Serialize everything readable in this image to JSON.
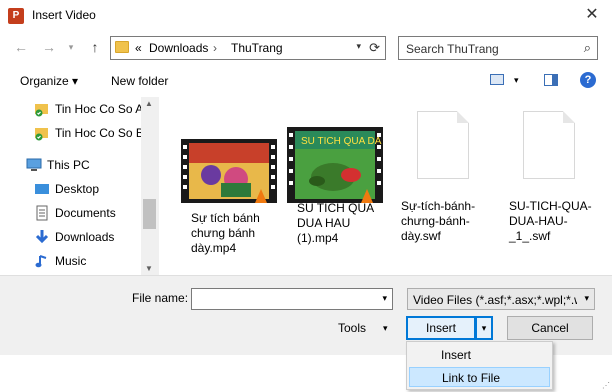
{
  "window": {
    "title": "Insert Video",
    "app_icon": "P"
  },
  "address": {
    "prefix": "«",
    "crumbs": [
      "Downloads",
      "ThuTrang"
    ],
    "separator": "›"
  },
  "search": {
    "placeholder": "Search ThuTrang"
  },
  "toolbar": {
    "organize": "Organize ▾",
    "new_folder": "New folder",
    "help": "?"
  },
  "sidebar": {
    "items": [
      {
        "label": "Tin Hoc Co So A",
        "icon": "folder-sync-icon"
      },
      {
        "label": "Tin Hoc Co So B",
        "icon": "folder-sync-icon"
      },
      {
        "label": "This PC",
        "icon": "computer-icon"
      },
      {
        "label": "Desktop",
        "icon": "desktop-icon"
      },
      {
        "label": "Documents",
        "icon": "documents-icon"
      },
      {
        "label": "Downloads",
        "icon": "downloads-icon"
      },
      {
        "label": "Music",
        "icon": "music-icon"
      }
    ]
  },
  "files": [
    {
      "name": "Sự tích bánh chưng bánh dày.mp4",
      "kind": "video"
    },
    {
      "name": "SU TICH QUA DUA HAU (1).mp4",
      "kind": "video"
    },
    {
      "name": "Sự-tích-bánh-chưng-bánh-dày.swf",
      "kind": "document"
    },
    {
      "name": "SU-TICH-QUA-DUA-HAU-_1_.swf",
      "kind": "document"
    }
  ],
  "bottom": {
    "file_name_label": "File name:",
    "file_name_value": "",
    "file_type": "Video Files (*.asf;*.asx;*.wpl;*.w",
    "tools": "Tools",
    "insert": "Insert",
    "cancel": "Cancel"
  },
  "menu": {
    "items": [
      "Insert",
      "Link to File"
    ],
    "highlighted": "Link to File"
  },
  "colors": {
    "accent": "#0078d7",
    "menu_highlight": "#cce8ff"
  }
}
